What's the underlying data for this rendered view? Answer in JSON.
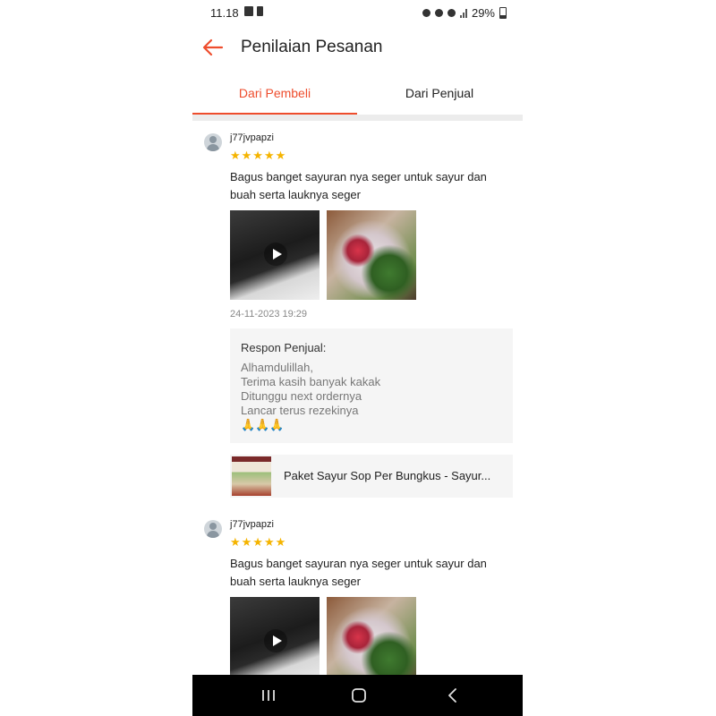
{
  "status_bar": {
    "time": "11.18",
    "battery": "29%"
  },
  "header": {
    "title": "Penilaian Pesanan"
  },
  "tabs": [
    {
      "label": "Dari Pembeli",
      "active": true
    },
    {
      "label": "Dari Penjual",
      "active": false
    }
  ],
  "reviews": [
    {
      "username": "j77jvpapzi",
      "stars": "★★★★★",
      "text": "Bagus banget sayuran nya seger untuk sayur dan buah serta lauknya seger",
      "date": "24-11-2023 19:29",
      "seller_response": {
        "title": "Respon Penjual:",
        "lines": [
          "Alhamdulillah,",
          "Terima kasih banyak kakak",
          "Ditunggu next ordernya",
          "Lancar terus rezekinya",
          "🙏🙏🙏"
        ]
      },
      "product": "Paket Sayur Sop Per Bungkus - Sayur..."
    },
    {
      "username": "j77jvpapzi",
      "stars": "★★★★★",
      "text": "Bagus banget sayuran nya seger untuk sayur dan buah serta lauknya seger"
    }
  ],
  "colors": {
    "accent": "#ee4d2d",
    "star": "#f5b400",
    "panel": "#f5f5f5"
  }
}
